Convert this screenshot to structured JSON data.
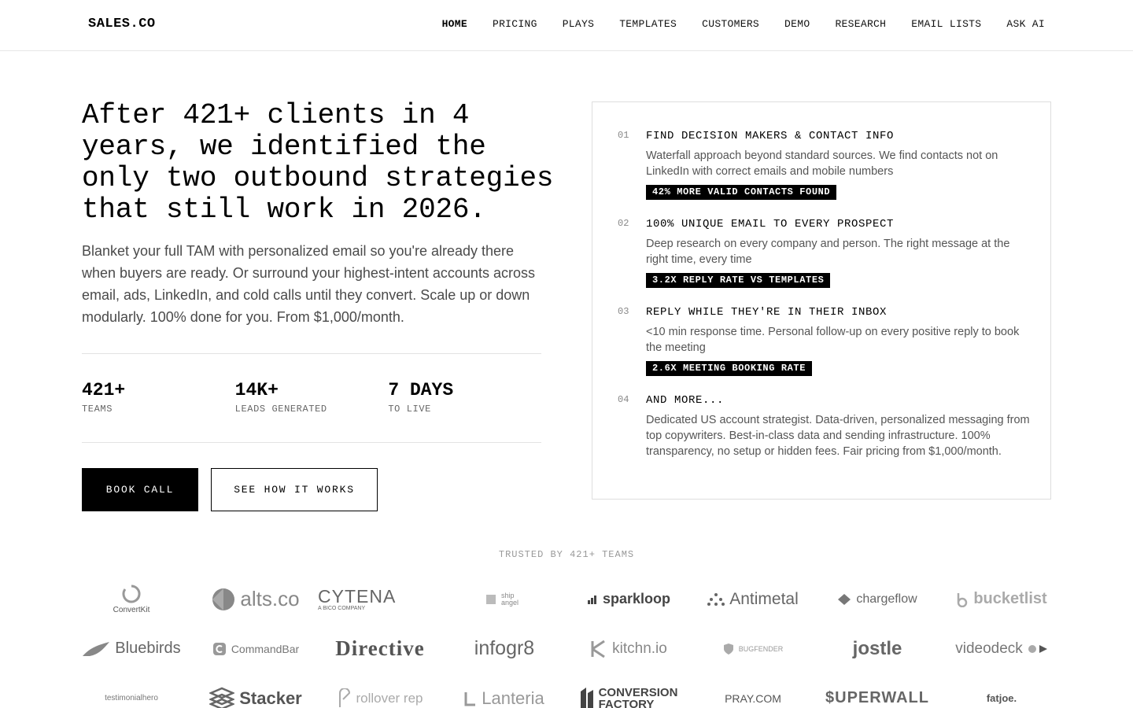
{
  "header": {
    "logo": "SALES.CO",
    "nav": [
      "HOME",
      "PRICING",
      "PLAYS",
      "TEMPLATES",
      "CUSTOMERS",
      "DEMO",
      "RESEARCH",
      "EMAIL LISTS",
      "ASK AI"
    ],
    "active_nav": "HOME"
  },
  "hero": {
    "title": "After 421+ clients in 4 years, we identified the only two outbound strategies that still work in 2026.",
    "subtitle": "Blanket your full TAM with personalized email so you're already there when buyers are ready. Or surround your highest-intent accounts across email, ads, LinkedIn, and cold calls until they convert. Scale up or down modularly. 100% done for you. From $1,000/month.",
    "stats": [
      {
        "value": "421+",
        "label": "TEAMS"
      },
      {
        "value": "14K+",
        "label": "LEADS GENERATED"
      },
      {
        "value": "7 DAYS",
        "label": "TO LIVE"
      }
    ],
    "primary_button": "BOOK CALL",
    "secondary_button": "SEE HOW IT WORKS"
  },
  "features": [
    {
      "num": "01",
      "title": "FIND DECISION MAKERS & CONTACT INFO",
      "desc": "Waterfall approach beyond standard sources. We find contacts not on LinkedIn with correct emails and mobile numbers",
      "badge": "42% MORE VALID CONTACTS FOUND"
    },
    {
      "num": "02",
      "title": "100% UNIQUE EMAIL TO EVERY PROSPECT",
      "desc": "Deep research on every company and person. The right message at the right time, every time",
      "badge": "3.2X REPLY RATE VS TEMPLATES"
    },
    {
      "num": "03",
      "title": "REPLY WHILE THEY'RE IN THEIR INBOX",
      "desc": "<10 min response time. Personal follow-up on every positive reply to book the meeting",
      "badge": "2.6X MEETING BOOKING RATE"
    },
    {
      "num": "04",
      "title": "AND MORE...",
      "desc": "Dedicated US account strategist. Data-driven, personalized messaging from top copywriters. Best-in-class data and sending infrastructure. 100% transparency, no setup or hidden fees. Fair pricing from $1,000/month.",
      "badge": ""
    }
  ],
  "trusted": {
    "heading": "TRUSTED BY 421+ TEAMS",
    "logos": [
      "ConvertKit",
      "alts.co",
      "CYTENA",
      "A BICO COMPANY",
      "ship angel",
      "sparkloop",
      "Antimetal",
      "chargeflow",
      "bucketlist",
      "Bluebirds",
      "CommandBar",
      "Directive",
      "infogr8",
      "kitchn.io",
      "BUGFENDER",
      "jostle",
      "videodeck",
      "testimonialhero",
      "Stacker",
      "rollover rep",
      "Lanteria",
      "CONVERSION",
      "FACTORY",
      "PRAY.COM",
      "$UPERWALL",
      "fatjoe."
    ]
  }
}
